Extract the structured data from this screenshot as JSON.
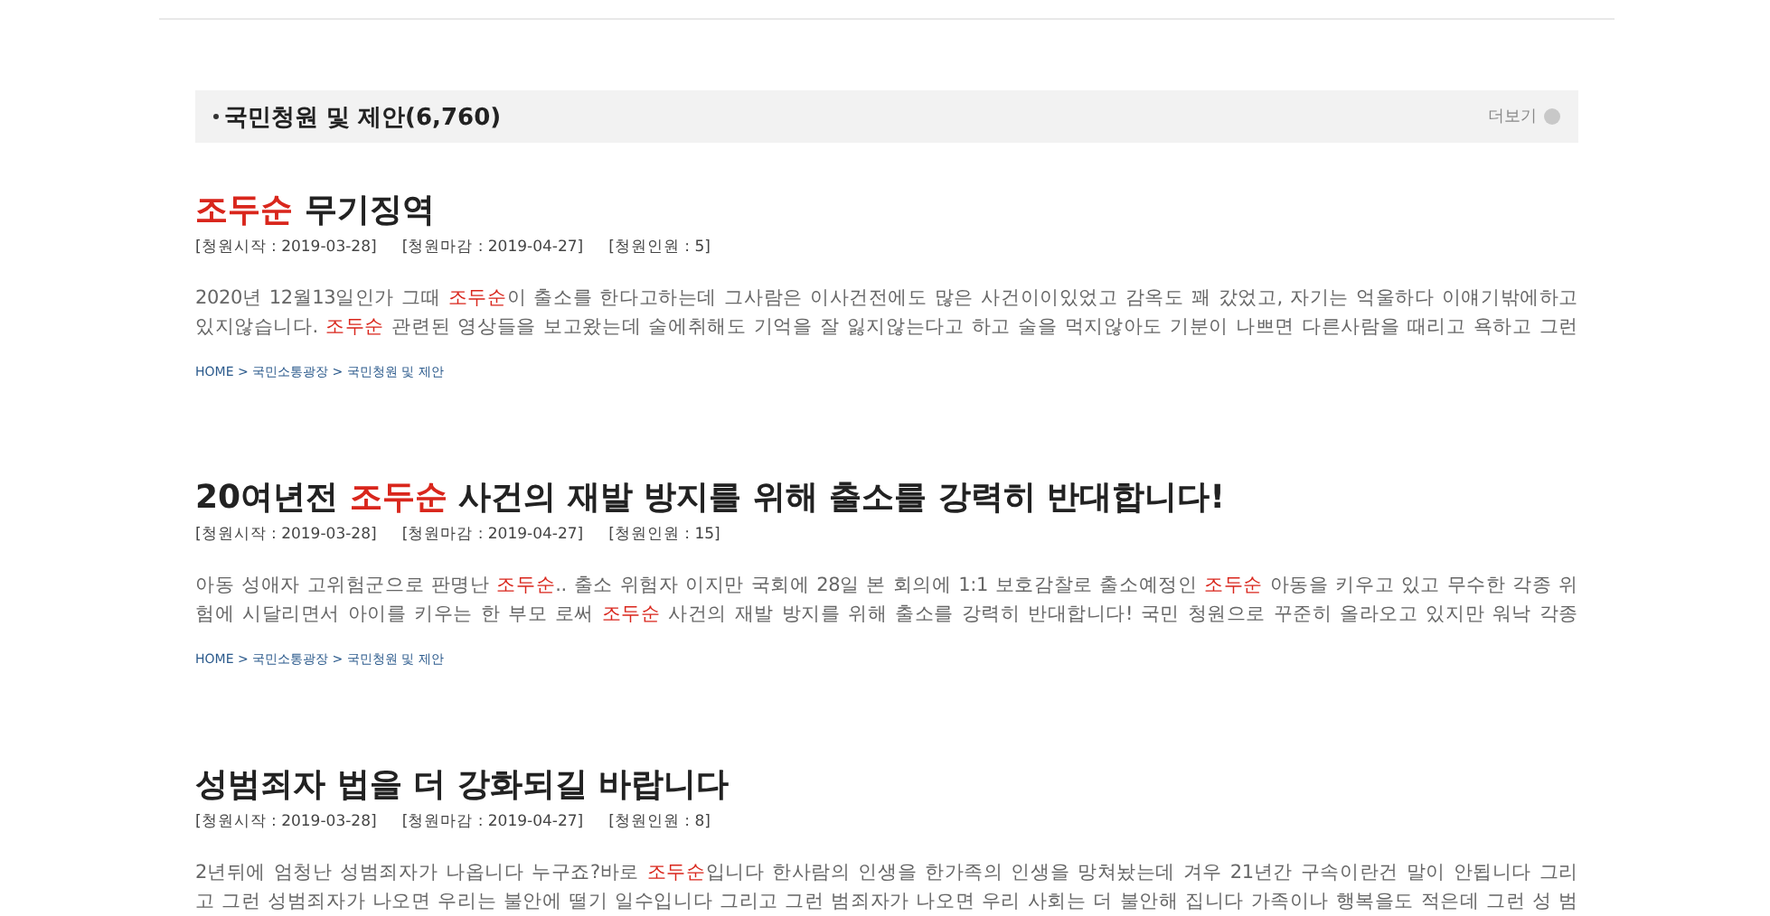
{
  "section": {
    "title": "국민청원 및 제안(6,760)",
    "more_label": "더보기"
  },
  "results": [
    {
      "title": [
        {
          "text": "조두순",
          "highlighted": true
        },
        {
          "text": " 무기징역",
          "highlighted": false
        }
      ],
      "meta": [
        "[청원시작 : 2019-03-28]",
        "[청원마감 : 2019-04-27]",
        "[청원인원 : 5]"
      ],
      "body": [
        [
          {
            "text": "2020년 12월13일인가 그때 ",
            "highlighted": false
          },
          {
            "text": "조두순",
            "highlighted": true
          },
          {
            "text": "이 출소를 한다고하는데 그사람은 이사건전에도 많은 사건이이있었고 감옥도 꽤 갔었고, 자기는 억울하다 이얘기밖에하고",
            "highlighted": false
          }
        ],
        [
          {
            "text": "있지않습니다. ",
            "highlighted": false
          },
          {
            "text": "조두순",
            "highlighted": true
          },
          {
            "text": " 관련된 영상들을 보고왔는데 술에취해도 기억을 잘 잃지않는다고 하고 술을 먹지않아도 기분이 나쁘면 다른사람을 때리고 욕하고 그런",
            "highlighted": false
          }
        ]
      ],
      "breadcrumb": "HOME > 국민소통광장 > 국민청원 및 제안"
    },
    {
      "title": [
        {
          "text": "20여년전 ",
          "highlighted": false
        },
        {
          "text": "조두순",
          "highlighted": true
        },
        {
          "text": " 사건의 재발 방지를 위해 출소를 강력히 반대합니다!",
          "highlighted": false
        }
      ],
      "meta": [
        "[청원시작 : 2019-03-28]",
        "[청원마감 : 2019-04-27]",
        "[청원인원 : 15]"
      ],
      "body": [
        [
          {
            "text": "아동 성애자 고위험군으로 판명난 ",
            "highlighted": false
          },
          {
            "text": "조두순",
            "highlighted": true
          },
          {
            "text": ".. 출소 위험자 이지만 국회에 28일 본 회의에 1:1 보호감찰로 출소예정인 ",
            "highlighted": false
          },
          {
            "text": "조두순",
            "highlighted": true
          },
          {
            "text": " 아동을 키우고 있고 무수한 각종 위",
            "highlighted": false
          }
        ],
        [
          {
            "text": "험에 시달리면서 아이를 키우는 한 부모 로써 ",
            "highlighted": false
          },
          {
            "text": "조두순",
            "highlighted": true
          },
          {
            "text": " 사건의 재발 방지를 위해 출소를 강력히 반대합니다! 국민 청원으로 꾸준히 올라오고 있지만 워낙 각종",
            "highlighted": false
          }
        ]
      ],
      "breadcrumb": "HOME > 국민소통광장 > 국민청원 및 제안"
    },
    {
      "title": [
        {
          "text": "성범죄자 법을 더 강화되길 바랍니다",
          "highlighted": false
        }
      ],
      "meta": [
        "[청원시작 : 2019-03-28]",
        "[청원마감 : 2019-04-27]",
        "[청원인원 : 8]"
      ],
      "body": [
        [
          {
            "text": "2년뒤에 엄청난 성범죄자가 나옵니다 누구죠?바로 ",
            "highlighted": false
          },
          {
            "text": "조두순",
            "highlighted": true
          },
          {
            "text": "입니다 한사람의 인생을 한가족의 인생을 망쳐놨는데 겨우 21년간 구속이란건 말이 안됩니다 그리",
            "highlighted": false
          }
        ],
        [
          {
            "text": "고 그런 성범죄자가 나오면 우리는 불안에 떨기 일수입니다 그리고 그런 범죄자가 나오면 우리 사회는 더 불안해 집니다 가족이나 행복을도 적은데 그런 성 범",
            "highlighted": false
          }
        ]
      ]
    }
  ]
}
